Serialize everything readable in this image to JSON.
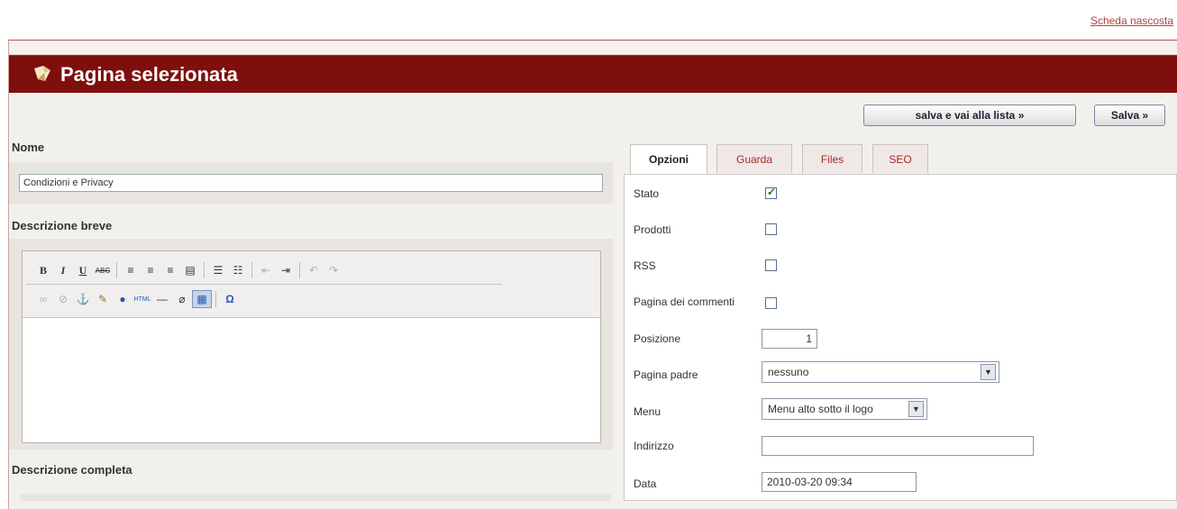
{
  "top_link": "Scheda nascosta",
  "header": {
    "title": "Pagina selezionata"
  },
  "actions": {
    "save_and_list": "salva e vai alla lista »",
    "save": "Salva »"
  },
  "left": {
    "name_label": "Nome",
    "name_value": "Condizioni e Privacy",
    "short_desc_label": "Descrizione breve",
    "full_desc_label": "Descrizione completa"
  },
  "tabs": [
    {
      "label": "Opzioni"
    },
    {
      "label": "Guarda"
    },
    {
      "label": "Files"
    },
    {
      "label": "SEO"
    }
  ],
  "options": {
    "stato_label": "Stato",
    "stato_checked": true,
    "prodotti_label": "Prodotti",
    "prodotti_checked": false,
    "rss_label": "RSS",
    "rss_checked": false,
    "commenti_label": "Pagina dei commenti",
    "commenti_checked": false,
    "posizione_label": "Posizione",
    "posizione_value": "1",
    "padre_label": "Pagina padre",
    "padre_value": "nessuno",
    "menu_label": "Menu",
    "menu_value": "Menu alto sotto il logo",
    "indirizzo_label": "Indirizzo",
    "indirizzo_value": "",
    "data_label": "Data",
    "data_value": "2010-03-20 09:34"
  },
  "editor_toolbar": {
    "row1": [
      "bold",
      "italic",
      "underline",
      "strikethrough",
      "align-left",
      "align-center",
      "align-right",
      "align-justify",
      "bullet-list",
      "numbered-list",
      "outdent",
      "indent",
      "undo",
      "redo"
    ],
    "row2": [
      "link",
      "unlink",
      "anchor",
      "cleanup",
      "help",
      "html",
      "horizontal-rule",
      "remove-format",
      "visual-aid",
      "special-char"
    ]
  },
  "colors": {
    "header_bg": "#7e0f0c",
    "tab_inactive_text": "#a52a2a"
  }
}
